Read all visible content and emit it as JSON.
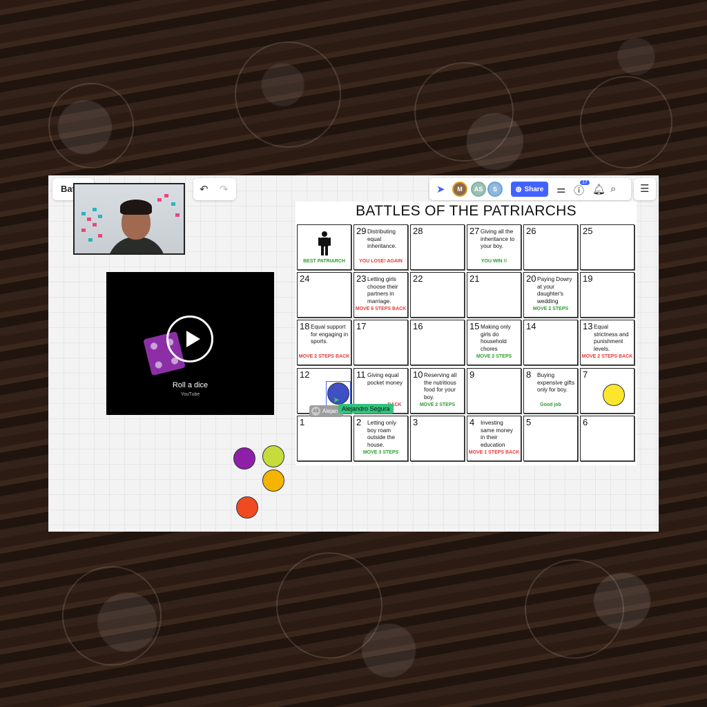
{
  "app": {
    "board_title_short": "Bat",
    "share_label": "Share",
    "help_badge": "17",
    "collaborators": [
      {
        "initials": "M",
        "color": "#e0a020"
      },
      {
        "initials": "AS",
        "color": "#7fb3a6"
      },
      {
        "initials": "S",
        "color": "#6aa3d8"
      }
    ]
  },
  "video": {
    "title": "Roll a dice",
    "source": "YouTube"
  },
  "board": {
    "title": "BATTLES OF THE PATRIARCHS",
    "cells": {
      "best": {
        "action": "BEST PATRIARCH"
      },
      "c29": {
        "num": "29",
        "desc": "Distributing equal inheritance.",
        "action": "YOU LOSE! AGAIN"
      },
      "c28": {
        "num": "28"
      },
      "c27": {
        "num": "27",
        "desc": "Giving all the inheritance to your boy.",
        "action": "YOU WIN !!"
      },
      "c26": {
        "num": "26"
      },
      "c25": {
        "num": "25"
      },
      "c24": {
        "num": "24"
      },
      "c23": {
        "num": "23",
        "desc": "Letting girls choose their partners in marriage.",
        "action": "MOVE 6 STEPS BACK"
      },
      "c22": {
        "num": "22"
      },
      "c21": {
        "num": "21"
      },
      "c20": {
        "num": "20",
        "desc": "Paying Dowry at your daughter's wedding",
        "action": "MOVE 2 STEPS"
      },
      "c19": {
        "num": "19"
      },
      "c18": {
        "num": "18",
        "desc": "Equal support for engaging in sports.",
        "action": "MOVE 2 STEPS BACK"
      },
      "c17": {
        "num": "17"
      },
      "c16": {
        "num": "16"
      },
      "c15": {
        "num": "15",
        "desc": "Making only girls do household chores",
        "action": "MOVE 2 STEPS"
      },
      "c14": {
        "num": "14"
      },
      "c13": {
        "num": "13",
        "desc": "Equal strictness and punishment levels.",
        "action": "MOVE 2 STEPS BACK"
      },
      "c12": {
        "num": "12"
      },
      "c11": {
        "num": "11",
        "desc": "Giving equal pocket money",
        "action": "BACK"
      },
      "c10": {
        "num": "10",
        "desc": "Reserving all the nutritious food for your boy.",
        "action": "MOVE 2 STEPS"
      },
      "c9": {
        "num": "9"
      },
      "c8": {
        "num": "8",
        "desc": "Buying expensive gifts only for boy.",
        "action": "Good job"
      },
      "c7": {
        "num": "7"
      },
      "c1": {
        "num": "1"
      },
      "c2": {
        "num": "2",
        "desc": "Letting only boy roam outside the house.",
        "action": "MOVE 3 STEPS"
      },
      "c3": {
        "num": "3"
      },
      "c4": {
        "num": "4",
        "desc": "Investing same money in their education",
        "action": "MOVE 1 STEPS BACK"
      },
      "c5": {
        "num": "5"
      },
      "c6": {
        "num": "6"
      }
    }
  },
  "cursor": {
    "user_name": "Alejandro Segura",
    "chip_initials": "AS",
    "chip_text": "Alejan"
  },
  "tokens": {
    "purple": "#8e1fa8",
    "lime": "#c6dc3a",
    "orange": "#f5b400",
    "red": "#f04a23",
    "yellow": "#fbe62b",
    "blue": "#3f4fc4"
  }
}
